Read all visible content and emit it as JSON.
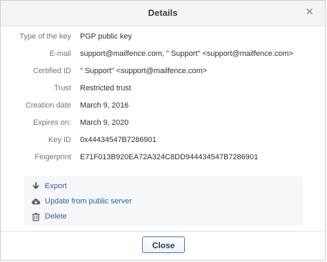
{
  "dialog": {
    "title": "Details",
    "close_icon": "close-icon"
  },
  "details": [
    {
      "label": "Type of the key",
      "value": "PGP public key"
    },
    {
      "label": "E-mail",
      "value": "support@mailfence.com, \" Support\" <support@mailfence.com>"
    },
    {
      "label": "Certified ID",
      "value": "\" Support\" <support@mailfence.com>"
    },
    {
      "label": "Trust",
      "value": "Restricted trust"
    },
    {
      "label": "Creation date",
      "value": "March 9, 2016"
    },
    {
      "label": "Expires on:",
      "value": "March 9, 2020"
    },
    {
      "label": "Key ID",
      "value": "0x44434547B7286901"
    },
    {
      "label": "Fingerprint",
      "value": "E71F013B920EA72A324C8DD944434547B7286901"
    }
  ],
  "actions": [
    {
      "label": "Export",
      "icon": "arrow-down-icon"
    },
    {
      "label": "Update from public server",
      "icon": "cloud-icon"
    },
    {
      "label": "Delete",
      "icon": "trash-icon"
    }
  ],
  "footer": {
    "close_label": "Close"
  },
  "colors": {
    "link": "#2f5f9c",
    "button_border": "#3b73b9",
    "label": "#6f747a"
  }
}
